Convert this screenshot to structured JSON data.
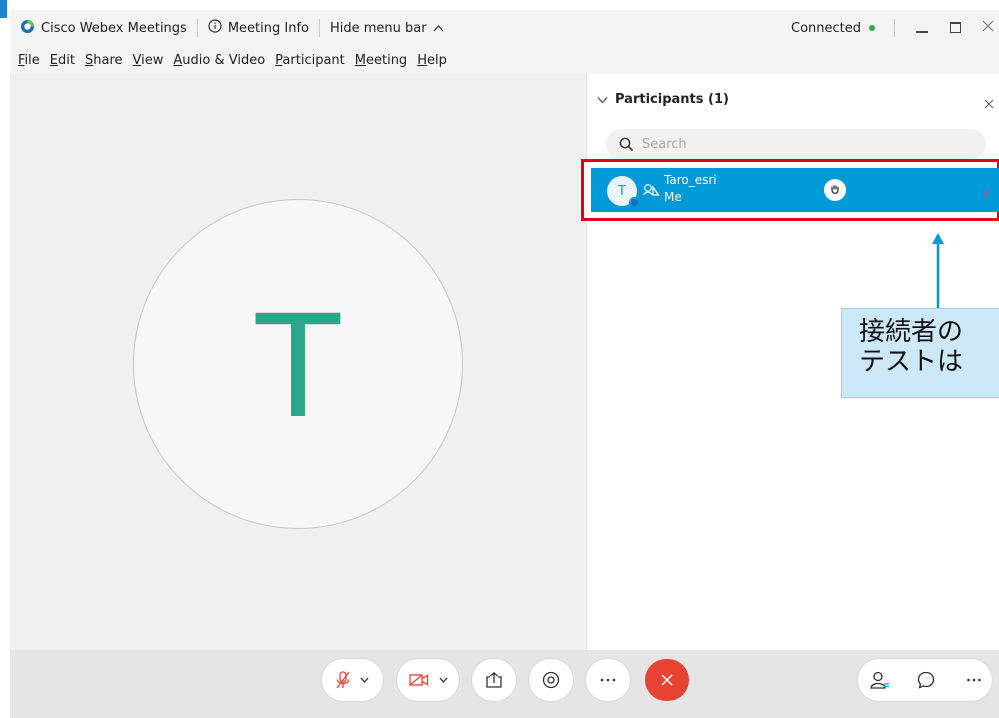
{
  "app": {
    "title": "Cisco Webex Meetings",
    "meeting_info": "Meeting Info",
    "hide_menu_bar": "Hide menu bar",
    "connected": "Connected"
  },
  "menu": {
    "items": [
      {
        "u": "F",
        "rest": "ile"
      },
      {
        "u": "E",
        "rest": "dit"
      },
      {
        "u": "S",
        "rest": "hare"
      },
      {
        "u": "V",
        "rest": "iew"
      },
      {
        "u": "A",
        "rest": "udio & Video"
      },
      {
        "u": "P",
        "rest": "articipant"
      },
      {
        "u": "M",
        "rest": "eeting"
      },
      {
        "u": "H",
        "rest": "elp"
      }
    ]
  },
  "stage": {
    "avatar_letter": "T"
  },
  "participants": {
    "title": "Participants (1)",
    "search_placeholder": "Search",
    "list": [
      {
        "name": "Taro_esri",
        "role": "Me",
        "avatar_letter": "T"
      }
    ]
  },
  "callout": {
    "line1": "接続者の",
    "line2": "テストは"
  },
  "colors": {
    "accent_blue": "#0099d8",
    "highlight_red": "#e0001b",
    "avatar_teal": "#2aa68a",
    "end_red": "#e84235",
    "callout_bg": "#cde9f9"
  }
}
